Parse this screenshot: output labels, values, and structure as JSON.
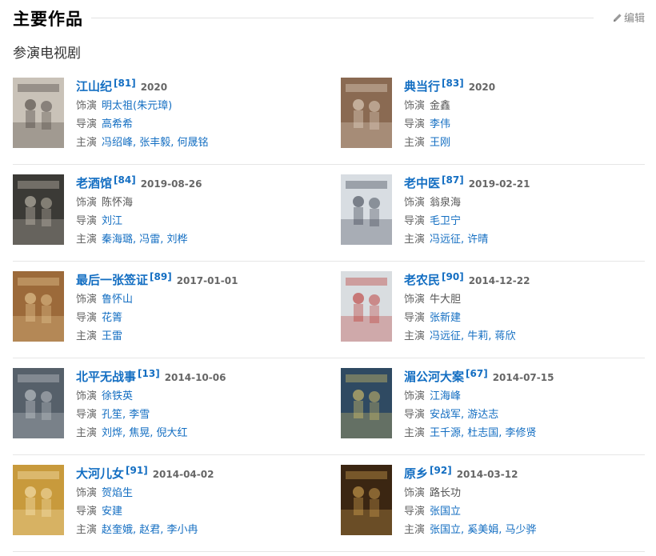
{
  "header": {
    "title": "主要作品",
    "edit_label": "编辑"
  },
  "section": {
    "title": "参演电视剧"
  },
  "labels": {
    "role": "饰演",
    "director": "导演",
    "starring": "主演"
  },
  "works": [
    {
      "title": "江山纪",
      "ref": "[81]",
      "date": "2020",
      "role": "明太祖(朱元璋)",
      "role_link": true,
      "director": "高希希",
      "starring": "冯绍峰, 张丰毅, 何晟铭",
      "poster": {
        "bg": "#c9c2b8",
        "accent": "#3a3430"
      }
    },
    {
      "title": "典当行",
      "ref": "[83]",
      "date": "2020",
      "role": "金鑫",
      "role_link": false,
      "director": "李伟",
      "starring": "王刚",
      "poster": {
        "bg": "#8a6a52",
        "accent": "#f2e6d6"
      }
    },
    {
      "title": "老酒馆",
      "ref": "[84]",
      "date": "2019-08-26",
      "role": "陈怀海",
      "role_link": false,
      "director": "刘江",
      "starring": "秦海璐, 冯雷, 刘桦",
      "poster": {
        "bg": "#3b3a36",
        "accent": "#d9d2c2"
      }
    },
    {
      "title": "老中医",
      "ref": "[87]",
      "date": "2019-02-21",
      "role": "翁泉海",
      "role_link": false,
      "director": "毛卫宁",
      "starring": "冯远征, 许晴",
      "poster": {
        "bg": "#d8dde2",
        "accent": "#2b3240"
      }
    },
    {
      "title": "最后一张签证",
      "ref": "[89]",
      "date": "2017-01-01",
      "role": "鲁怀山",
      "role_link": true,
      "director": "花箐",
      "starring": "王雷",
      "poster": {
        "bg": "#9c6a3a",
        "accent": "#f3d7a2"
      }
    },
    {
      "title": "老农民",
      "ref": "[90]",
      "date": "2014-12-22",
      "role": "牛大胆",
      "role_link": false,
      "director": "张新建",
      "starring": "冯远征, 牛莉, 蒋欣",
      "poster": {
        "bg": "#d9dde0",
        "accent": "#b82420"
      }
    },
    {
      "title": "北平无战事",
      "ref": "[13]",
      "date": "2014-10-06",
      "role": "徐铁英",
      "role_link": true,
      "director": "孔笙, 李雪",
      "starring": "刘烨, 焦晃, 倪大红",
      "poster": {
        "bg": "#56606a",
        "accent": "#d5d8da"
      }
    },
    {
      "title": "湄公河大案",
      "ref": "[67]",
      "date": "2014-07-15",
      "role": "江海峰",
      "role_link": true,
      "director": "安战军, 游达志",
      "starring": "王千源, 杜志国, 李修贤",
      "poster": {
        "bg": "#2f4a62",
        "accent": "#f2d36a"
      }
    },
    {
      "title": "大河儿女",
      "ref": "[91]",
      "date": "2014-04-02",
      "role": "贺焰生",
      "role_link": true,
      "director": "安建",
      "starring": "赵奎娥, 赵君, 李小冉",
      "poster": {
        "bg": "#c89a3c",
        "accent": "#fff1c9"
      }
    },
    {
      "title": "原乡",
      "ref": "[92]",
      "date": "2014-03-12",
      "role": "路长功",
      "role_link": false,
      "director": "张国立",
      "starring": "张国立, 奚美娟, 马少骅",
      "poster": {
        "bg": "#3b2612",
        "accent": "#e7b45a"
      }
    }
  ]
}
